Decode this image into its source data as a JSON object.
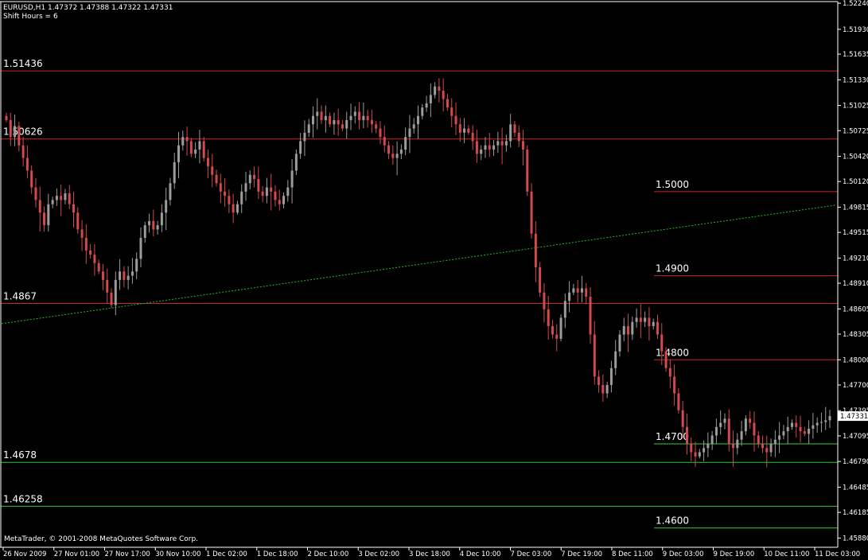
{
  "header": {
    "symbol_line": "EURUSD,H1  1.47372 1.47388 1.47322 1.47331",
    "shift_line": "Shift Hours = 6"
  },
  "footer": {
    "copyright": "MetaTrader, © 2001-2008 MetaQuotes Software Corp."
  },
  "colors": {
    "background": "#000000",
    "axis": "#ffffff",
    "bull_candle": "#9c9c9c",
    "bear_candle": "#d24a4a",
    "red_level": "#c8262b",
    "green_level": "#33cc33",
    "trendline": "#22bb22"
  },
  "chart_data": {
    "type": "candlestick",
    "symbol": "EURUSD",
    "timeframe": "H1",
    "last_quote": {
      "open": 1.47372,
      "high": 1.47388,
      "low": 1.47322,
      "close": 1.47331
    },
    "current_price_label": "1.47331",
    "ylim": [
      1.4577,
      1.5226
    ],
    "y_ticks": [
      "1.52240",
      "1.51930",
      "1.51635",
      "1.51330",
      "1.51025",
      "1.50725",
      "1.50420",
      "1.50120",
      "1.49815",
      "1.49515",
      "1.49210",
      "1.48910",
      "1.48605",
      "1.48305",
      "1.48000",
      "1.47700",
      "1.47395",
      "1.47095",
      "1.46790",
      "1.46485",
      "1.46185",
      "1.45880"
    ],
    "y_tick_values": [
      1.5224,
      1.5193,
      1.51635,
      1.5133,
      1.51025,
      1.50725,
      1.5042,
      1.5012,
      1.49815,
      1.49515,
      1.4921,
      1.4891,
      1.48605,
      1.48305,
      1.48,
      1.477,
      1.47395,
      1.47095,
      1.4679,
      1.46485,
      1.46185,
      1.4588
    ],
    "x_ticks": [
      "26 Nov 2009",
      "27 Nov 01:00",
      "27 Nov 17:00",
      "30 Nov 10:00",
      "1 Dec 02:00",
      "1 Dec 18:00",
      "2 Dec 10:00",
      "3 Dec 02:00",
      "3 Dec 18:00",
      "4 Dec 10:00",
      "7 Dec 03:00",
      "7 Dec 19:00",
      "8 Dec 11:00",
      "9 Dec 03:00",
      "9 Dec 19:00",
      "10 Dec 11:00",
      "11 Dec 03:00"
    ],
    "horizontal_levels": [
      {
        "label": "1.51436",
        "value": 1.51436,
        "color": "red",
        "start": "left"
      },
      {
        "label": "1.50626",
        "value": 1.50626,
        "color": "red",
        "start": "left"
      },
      {
        "label": "1.5000",
        "value": 1.5,
        "color": "red",
        "start": "right"
      },
      {
        "label": "1.4900",
        "value": 1.49,
        "color": "red",
        "start": "right"
      },
      {
        "label": "1.4867",
        "value": 1.4867,
        "color": "red",
        "start": "left"
      },
      {
        "label": "1.4800",
        "value": 1.48,
        "color": "red",
        "start": "right"
      },
      {
        "label": "1.4700",
        "value": 1.47,
        "color": "green",
        "start": "right"
      },
      {
        "label": "1.4678",
        "value": 1.4678,
        "color": "green",
        "start": "left"
      },
      {
        "label": "1.46258",
        "value": 1.46258,
        "color": "green",
        "start": "left"
      },
      {
        "label": "1.4600",
        "value": 1.46,
        "color": "green",
        "start": "right"
      }
    ],
    "trendline": {
      "start_value": 1.4843,
      "end_value": 1.4984,
      "style": "dotted"
    },
    "closes": [
      1.5085,
      1.5065,
      1.5078,
      1.5055,
      1.504,
      1.5025,
      1.5005,
      1.499,
      1.4975,
      1.496,
      1.4985,
      1.499,
      1.4995,
      1.499,
      1.4998,
      1.4985,
      1.4975,
      1.4955,
      1.4945,
      1.493,
      1.4925,
      1.4915,
      1.4905,
      1.4895,
      1.488,
      1.4865,
      1.4895,
      1.4905,
      1.4895,
      1.49,
      1.4905,
      1.492,
      1.4945,
      1.496,
      1.4965,
      1.4955,
      1.496,
      1.4975,
      1.499,
      1.501,
      1.5035,
      1.5055,
      1.5065,
      1.506,
      1.5045,
      1.505,
      1.506,
      1.504,
      1.503,
      1.502,
      1.501,
      1.5,
      1.4995,
      1.4985,
      1.4975,
      1.4985,
      1.5,
      1.501,
      1.502,
      1.5015,
      1.5,
      1.4995,
      1.5005,
      1.5,
      1.499,
      1.4985,
      1.4995,
      1.5005,
      1.5025,
      1.5045,
      1.506,
      1.507,
      1.508,
      1.509,
      1.5095,
      1.5085,
      1.509,
      1.508,
      1.5085,
      1.508,
      1.5075,
      1.5085,
      1.509,
      1.5095,
      1.5085,
      1.509,
      1.5085,
      1.508,
      1.5075,
      1.5065,
      1.5055,
      1.5045,
      1.504,
      1.5045,
      1.505,
      1.5065,
      1.5075,
      1.508,
      1.509,
      1.51,
      1.5105,
      1.5115,
      1.5125,
      1.512,
      1.511,
      1.51,
      1.509,
      1.508,
      1.507,
      1.5075,
      1.507,
      1.506,
      1.5045,
      1.505,
      1.5055,
      1.505,
      1.5055,
      1.506,
      1.5055,
      1.506,
      1.508,
      1.507,
      1.506,
      1.505,
      1.5,
      1.495,
      1.491,
      1.488,
      1.486,
      1.484,
      1.483,
      1.4825,
      1.485,
      1.487,
      1.488,
      1.4885,
      1.488,
      1.4885,
      1.4875,
      1.483,
      1.478,
      1.477,
      1.476,
      1.477,
      1.479,
      1.481,
      1.483,
      1.484,
      1.483,
      1.4845,
      1.485,
      1.4845,
      1.485,
      1.484,
      1.4845,
      1.483,
      1.481,
      1.479,
      1.478,
      1.476,
      1.474,
      1.472,
      1.47,
      1.469,
      1.4685,
      1.469,
      1.4695,
      1.47,
      1.471,
      1.472,
      1.4725,
      1.473,
      1.47,
      1.4695,
      1.4705,
      1.4715,
      1.473,
      1.4725,
      1.471,
      1.47,
      1.4695,
      1.469,
      1.47,
      1.4705,
      1.471,
      1.4715,
      1.472,
      1.4725,
      1.472,
      1.4715,
      1.4712,
      1.4718,
      1.4722,
      1.4725,
      1.4726,
      1.4728,
      1.4733
    ]
  }
}
